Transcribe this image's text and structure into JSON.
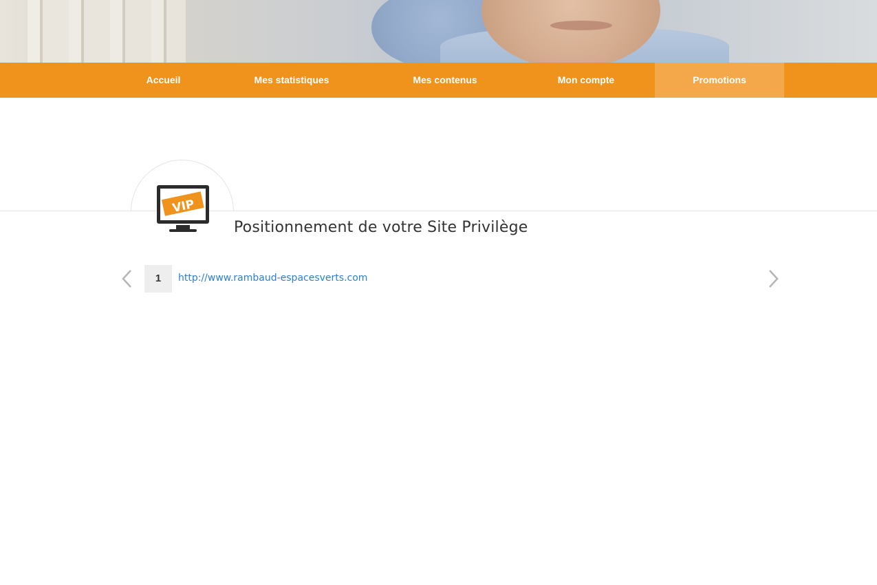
{
  "hero": {
    "image": "man-smiling-photo"
  },
  "nav": {
    "items": [
      {
        "label": "Accueil"
      },
      {
        "label": "Mes statistiques"
      },
      {
        "label": "Mes contenus"
      },
      {
        "label": "Mon compte"
      },
      {
        "label": "Promotions",
        "active": true
      }
    ]
  },
  "section": {
    "icon": "vip-monitor-icon",
    "title": "Positionnement de votre Site Privilège"
  },
  "pager": {
    "current_page": "1",
    "url": "http://www.rambaud-espacesverts.com",
    "prev_icon": "chevron-left-icon",
    "next_icon": "chevron-right-icon"
  },
  "colors": {
    "nav_bg": "#f0931c",
    "nav_active_bg": "#f4a84a",
    "link": "#2a7fd6"
  }
}
